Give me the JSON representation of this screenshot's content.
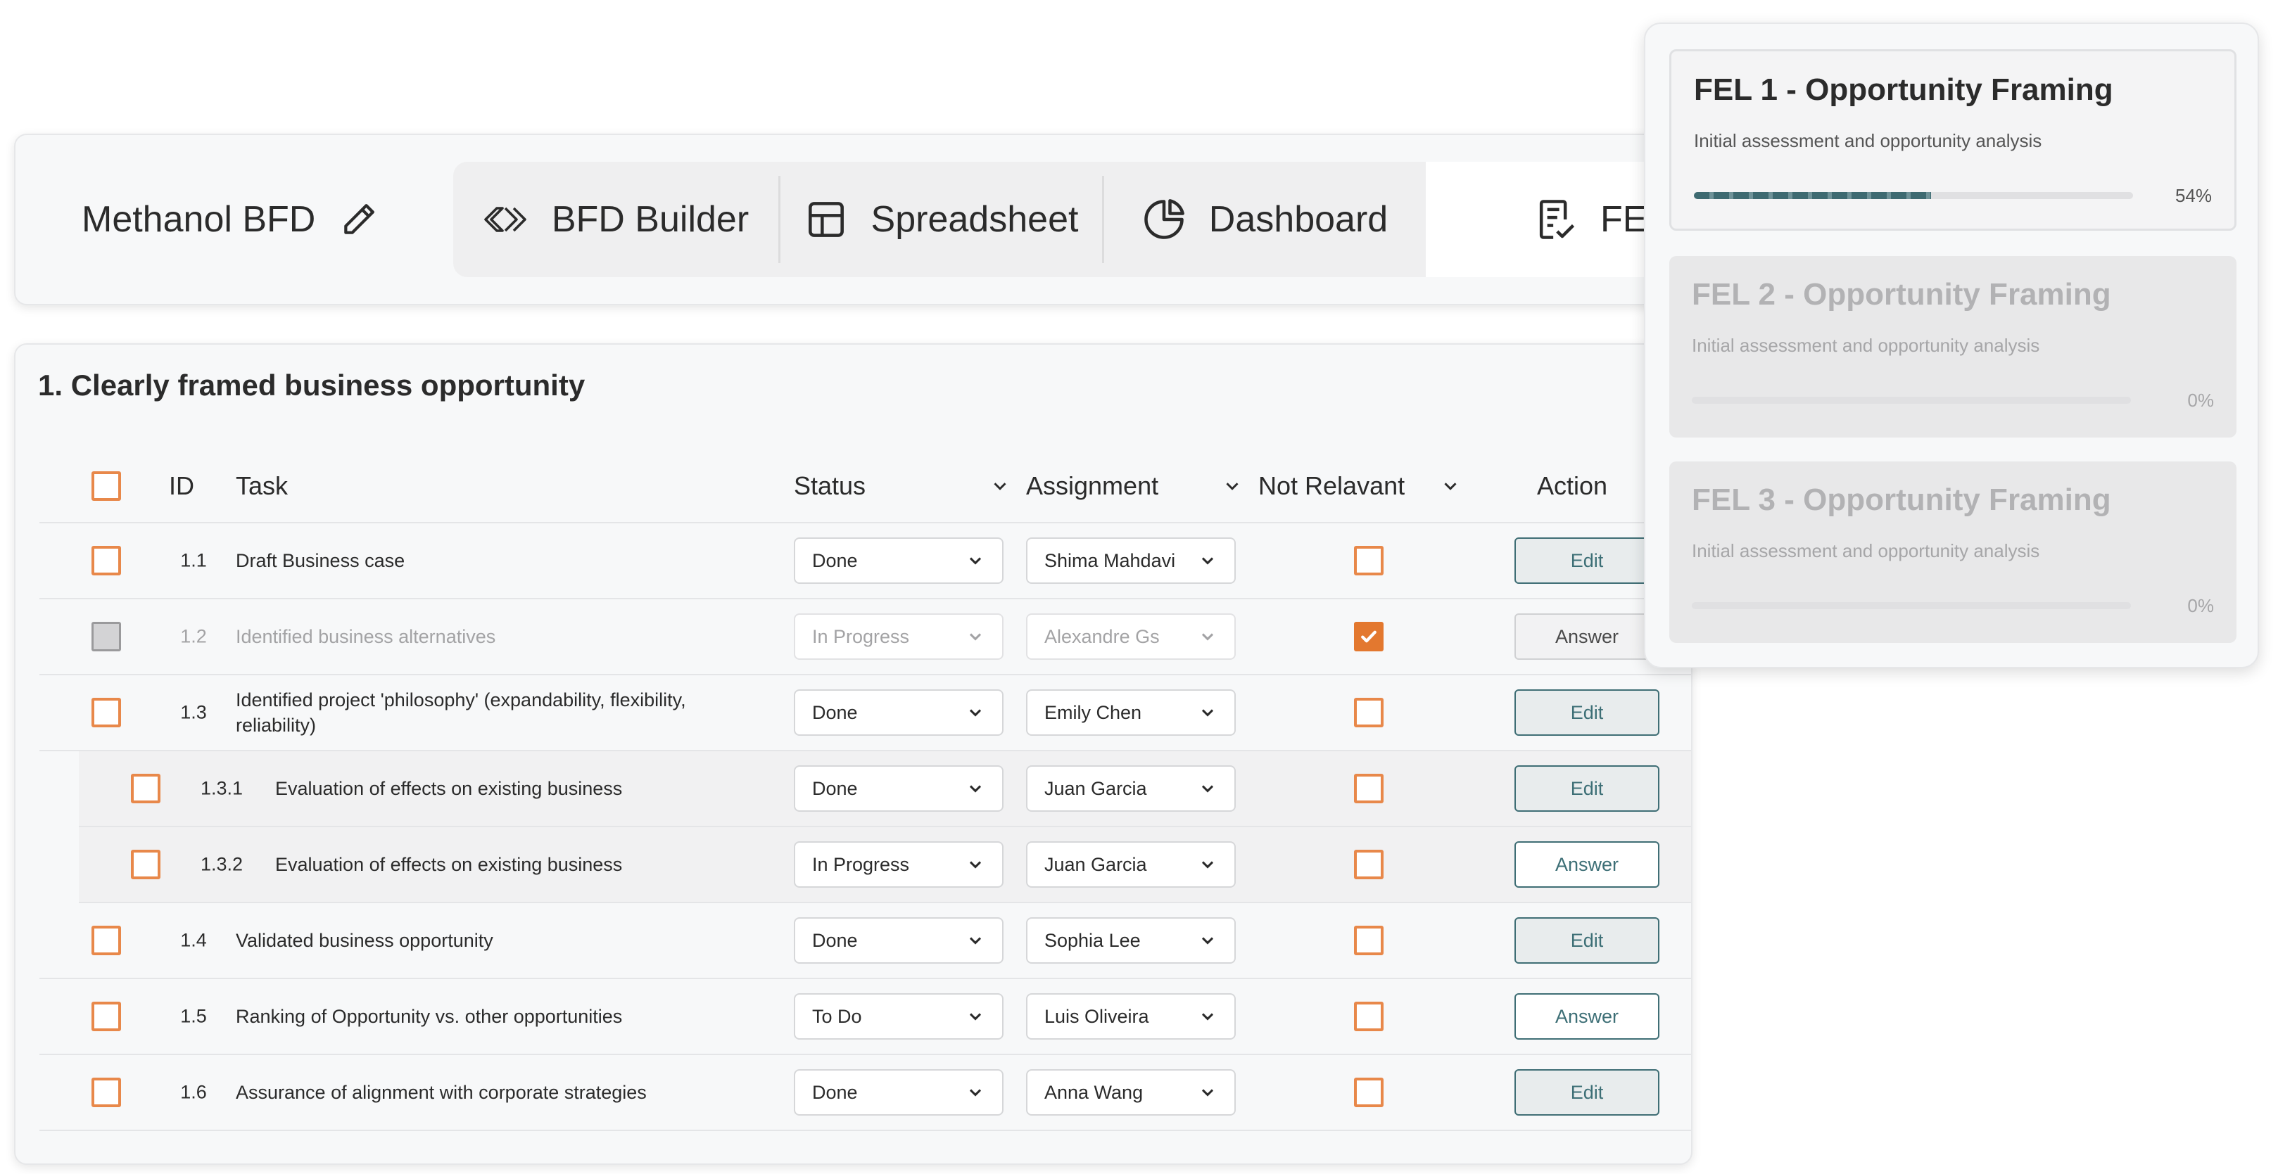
{
  "project": {
    "name": "Methanol BFD"
  },
  "tabs": [
    {
      "label": "BFD Builder",
      "icon": "chevrons-right-icon"
    },
    {
      "label": "Spreadsheet",
      "icon": "table-icon"
    },
    {
      "label": "Dashboard",
      "icon": "pie-chart-icon"
    },
    {
      "label": "FE",
      "icon": "clipboard-check-icon"
    }
  ],
  "section": {
    "title": "1. Clearly framed business opportunity"
  },
  "table": {
    "headers": {
      "id": "ID",
      "task": "Task",
      "status": "Status",
      "assignment": "Assignment",
      "not_relevant": "Not Relavant",
      "action": "Action"
    },
    "rows": [
      {
        "id": "1.1",
        "task": "Draft Business case",
        "status": "Done",
        "assignee": "Shima Mahdavi",
        "not_relevant": false,
        "action": "Edit"
      },
      {
        "id": "1.2",
        "task": "Identified business alternatives",
        "status": "In Progress",
        "assignee": "Alexandre Gs",
        "not_relevant": true,
        "action": "Answer"
      },
      {
        "id": "1.3",
        "task": "Identified project 'philosophy' (expandability, flexibility, reliability)",
        "status": "Done",
        "assignee": "Emily Chen",
        "not_relevant": false,
        "action": "Edit"
      },
      {
        "id": "1.3.1",
        "task": "Evaluation of effects on existing business",
        "status": "Done",
        "assignee": "Juan Garcia",
        "not_relevant": false,
        "action": "Edit"
      },
      {
        "id": "1.3.2",
        "task": "Evaluation of effects on existing business",
        "status": "In Progress",
        "assignee": "Juan Garcia",
        "not_relevant": false,
        "action": "Answer"
      },
      {
        "id": "1.4",
        "task": "Validated business opportunity",
        "status": "Done",
        "assignee": "Sophia Lee",
        "not_relevant": false,
        "action": "Edit"
      },
      {
        "id": "1.5",
        "task": "Ranking of Opportunity vs. other opportunities",
        "status": "To Do",
        "assignee": "Luis Oliveira",
        "not_relevant": false,
        "action": "Answer"
      },
      {
        "id": "1.6",
        "task": "Assurance of alignment with corporate strategies",
        "status": "Done",
        "assignee": "Anna Wang",
        "not_relevant": false,
        "action": "Edit"
      }
    ]
  },
  "fel_panel": {
    "stages": [
      {
        "title": "FEL 1 - Opportunity Framing",
        "subtitle": "Initial assessment and opportunity analysis",
        "progress": 54,
        "progress_label": "54%"
      },
      {
        "title": "FEL 2 - Opportunity Framing",
        "subtitle": "Initial assessment and opportunity analysis",
        "progress": 0,
        "progress_label": "0%"
      },
      {
        "title": "FEL 3 - Opportunity Framing",
        "subtitle": "Initial assessment and opportunity analysis",
        "progress": 0,
        "progress_label": "0%"
      }
    ]
  },
  "colors": {
    "accent_orange": "#E3782F",
    "teal": "#3E6A71"
  }
}
